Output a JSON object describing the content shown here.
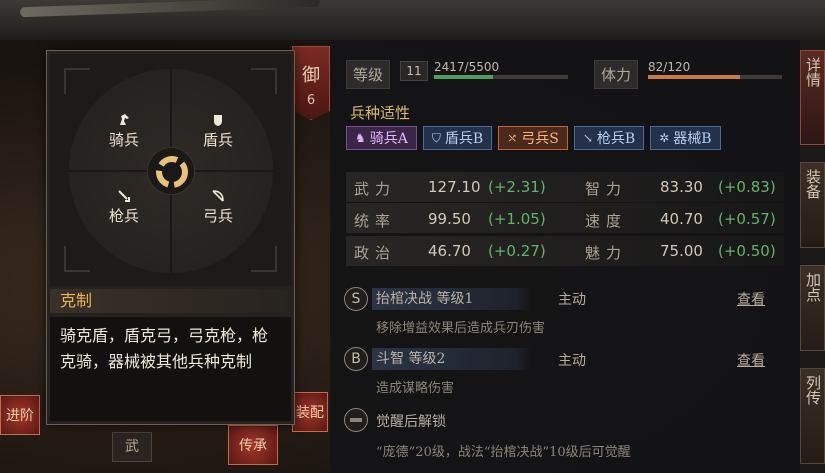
{
  "defense_tag": {
    "label": "御",
    "value": "6"
  },
  "level": {
    "label": "等级",
    "value": "11",
    "exp_text": "2417/5500",
    "exp_fraction": 0.44,
    "bar_color": "#4fa05a"
  },
  "stamina": {
    "label": "体力",
    "text": "82/120",
    "fraction": 0.683,
    "bar_color": "#c97a3f"
  },
  "troop_section": {
    "title": "兵种适性",
    "chips": [
      {
        "label": "骑兵A",
        "icon": "horse-icon",
        "grade": "A"
      },
      {
        "label": "盾兵B",
        "icon": "shield-icon",
        "grade": "B"
      },
      {
        "label": "弓兵S",
        "icon": "bow-icon",
        "grade": "S"
      },
      {
        "label": "枪兵B",
        "icon": "spear-icon",
        "grade": "B"
      },
      {
        "label": "器械B",
        "icon": "gear-icon",
        "grade": "B"
      }
    ]
  },
  "stats": [
    {
      "name": "武力",
      "value": "127.10",
      "bonus": "(+2.31)"
    },
    {
      "name": "智力",
      "value": "83.30",
      "bonus": "(+0.83)"
    },
    {
      "name": "统率",
      "value": "99.50",
      "bonus": "(+1.05)"
    },
    {
      "name": "速度",
      "value": "40.70",
      "bonus": "(+0.57)"
    },
    {
      "name": "政治",
      "value": "46.70",
      "bonus": "(+0.27)"
    },
    {
      "name": "魅力",
      "value": "75.00",
      "bonus": "(+0.50)"
    }
  ],
  "skills": [
    {
      "grade": "S",
      "name": "抬棺决战 等级1",
      "type": "主动",
      "view": "查看",
      "desc": "移除增益效果后造成兵刃伤害"
    },
    {
      "grade": "B",
      "name": "斗智 等级2",
      "type": "主动",
      "view": "查看",
      "desc": "造成谋略伤害"
    }
  ],
  "awaken": {
    "title": "觉醒后解锁",
    "desc": "“庞德”20级，战法“抬棺决战”10级后可觉醒"
  },
  "right_edge": {
    "btn1": "详情",
    "btn2": "装备",
    "btn3": "加点",
    "btn4": "列传"
  },
  "left_bottom": {
    "advance": "进阶",
    "inherit": "传承",
    "equip": "装配",
    "wu_tab": "武"
  },
  "popup": {
    "wheel_units": [
      {
        "name": "骑兵",
        "icon": "horse-icon"
      },
      {
        "name": "盾兵",
        "icon": "shield-icon"
      },
      {
        "name": "枪兵",
        "icon": "spear-icon"
      },
      {
        "name": "弓兵",
        "icon": "bow-icon"
      }
    ],
    "title": "克制",
    "desc": "骑克盾，盾克弓，弓克枪，枪克骑，器械被其他兵种克制"
  },
  "colors": {
    "gold": "#e8b850",
    "bonus_green": "#5fb569",
    "grade_S": "#ffb47a",
    "grade_A": "#e3b6ff",
    "grade_B": "#b8cdf0"
  }
}
